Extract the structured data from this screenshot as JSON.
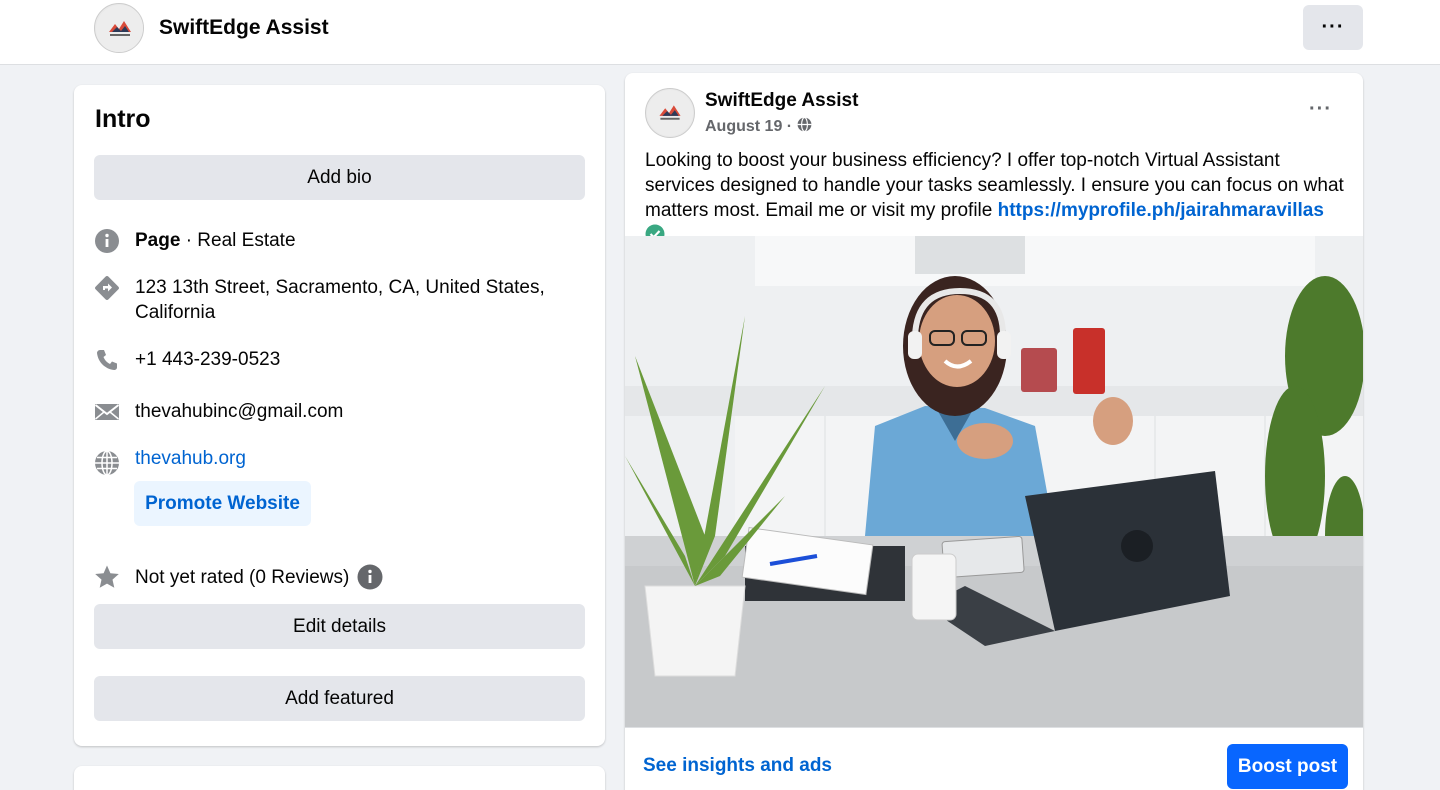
{
  "header": {
    "page_name": "SwiftEdge Assist",
    "more_label": "···"
  },
  "intro": {
    "title": "Intro",
    "add_bio": "Add bio",
    "page_label": "Page",
    "category": " · Real Estate",
    "address": "123 13th Street, Sacramento, CA, United States, California",
    "phone": "+1 443-239-0523",
    "email": "thevahubinc@gmail.com",
    "website": "thevahub.org",
    "promote_website": "Promote Website",
    "rating": "Not yet rated (0 Reviews)",
    "edit_details": "Edit details",
    "add_featured": "Add featured"
  },
  "post": {
    "author": "SwiftEdge Assist",
    "date": "August 19 ·",
    "more_label": "···",
    "text": "Looking to boost your business efficiency? I offer top-notch Virtual Assistant services designed to handle your tasks seamlessly. I ensure you can focus on what matters most. Email me or visit my profile ",
    "link": "https://myprofile.ph/jairahmaravillas",
    "insights": "See insights and ads",
    "boost": "Boost post"
  },
  "colors": {
    "accent_blue": "#0064d1",
    "boost_blue": "#0866ff",
    "background": "#f0f2f5"
  },
  "icons": [
    "info-icon",
    "directions-icon",
    "phone-icon",
    "email-icon",
    "globe-icon",
    "star-icon",
    "verified-check-icon",
    "more-dots-icon"
  ]
}
